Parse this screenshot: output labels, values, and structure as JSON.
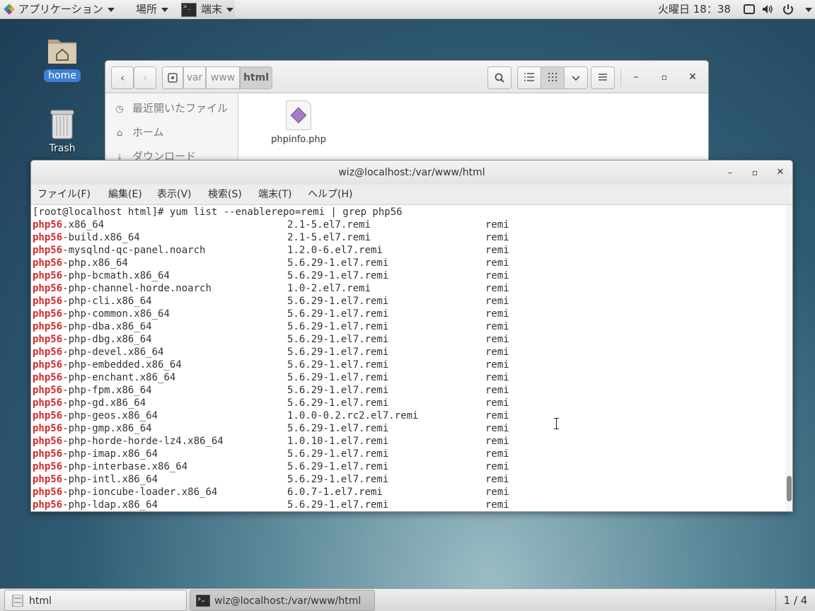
{
  "top_panel": {
    "applications": "アプリケーション",
    "places": "場所",
    "app_menu": "端末",
    "clock": "火曜日 18：38"
  },
  "desktop": {
    "home_label": "home",
    "trash_label": "Trash"
  },
  "files_window": {
    "path": [
      "var",
      "www",
      "html"
    ],
    "sidebar": [
      {
        "label": "最近開いたファイル",
        "icon": "clock-icon"
      },
      {
        "label": "ホーム",
        "icon": "home-icon"
      },
      {
        "label": "ダウンロード",
        "icon": "download-icon"
      }
    ],
    "file_name": "phpinfo.php"
  },
  "terminal": {
    "title": "wiz@localhost:/var/www/html",
    "menu": [
      "ファイル(F)",
      "編集(E)",
      "表示(V)",
      "検索(S)",
      "端末(T)",
      "ヘルプ(H)"
    ],
    "prompt_line": "[root@localhost html]# yum list --enablerepo=remi | grep php56",
    "highlight": "php56",
    "rows": [
      {
        "suffix": ".x86_64",
        "version": "2.1-5.el7.remi",
        "repo": "remi"
      },
      {
        "suffix": "-build.x86_64",
        "version": "2.1-5.el7.remi",
        "repo": "remi"
      },
      {
        "suffix": "-mysqlnd-qc-panel.noarch",
        "version": "1.2.0-6.el7.remi",
        "repo": "remi"
      },
      {
        "suffix": "-php.x86_64",
        "version": "5.6.29-1.el7.remi",
        "repo": "remi"
      },
      {
        "suffix": "-php-bcmath.x86_64",
        "version": "5.6.29-1.el7.remi",
        "repo": "remi"
      },
      {
        "suffix": "-php-channel-horde.noarch",
        "version": "1.0-2.el7.remi",
        "repo": "remi"
      },
      {
        "suffix": "-php-cli.x86_64",
        "version": "5.6.29-1.el7.remi",
        "repo": "remi"
      },
      {
        "suffix": "-php-common.x86_64",
        "version": "5.6.29-1.el7.remi",
        "repo": "remi"
      },
      {
        "suffix": "-php-dba.x86_64",
        "version": "5.6.29-1.el7.remi",
        "repo": "remi"
      },
      {
        "suffix": "-php-dbg.x86_64",
        "version": "5.6.29-1.el7.remi",
        "repo": "remi"
      },
      {
        "suffix": "-php-devel.x86_64",
        "version": "5.6.29-1.el7.remi",
        "repo": "remi"
      },
      {
        "suffix": "-php-embedded.x86_64",
        "version": "5.6.29-1.el7.remi",
        "repo": "remi"
      },
      {
        "suffix": "-php-enchant.x86_64",
        "version": "5.6.29-1.el7.remi",
        "repo": "remi"
      },
      {
        "suffix": "-php-fpm.x86_64",
        "version": "5.6.29-1.el7.remi",
        "repo": "remi"
      },
      {
        "suffix": "-php-gd.x86_64",
        "version": "5.6.29-1.el7.remi",
        "repo": "remi"
      },
      {
        "suffix": "-php-geos.x86_64",
        "version": "1.0.0-0.2.rc2.el7.remi",
        "repo": "remi"
      },
      {
        "suffix": "-php-gmp.x86_64",
        "version": "5.6.29-1.el7.remi",
        "repo": "remi"
      },
      {
        "suffix": "-php-horde-horde-lz4.x86_64",
        "version": "1.0.10-1.el7.remi",
        "repo": "remi"
      },
      {
        "suffix": "-php-imap.x86_64",
        "version": "5.6.29-1.el7.remi",
        "repo": "remi"
      },
      {
        "suffix": "-php-interbase.x86_64",
        "version": "5.6.29-1.el7.remi",
        "repo": "remi"
      },
      {
        "suffix": "-php-intl.x86_64",
        "version": "5.6.29-1.el7.remi",
        "repo": "remi"
      },
      {
        "suffix": "-php-ioncube-loader.x86_64",
        "version": "6.0.7-1.el7.remi",
        "repo": "remi"
      },
      {
        "suffix": "-php-ldap.x86_64",
        "version": "5.6.29-1.el7.remi",
        "repo": "remi"
      }
    ],
    "scroll_position": 0.97
  },
  "bottom_panel": {
    "tasks": [
      "html",
      "wiz@localhost:/var/www/html"
    ],
    "workspace": "1 / 4"
  }
}
